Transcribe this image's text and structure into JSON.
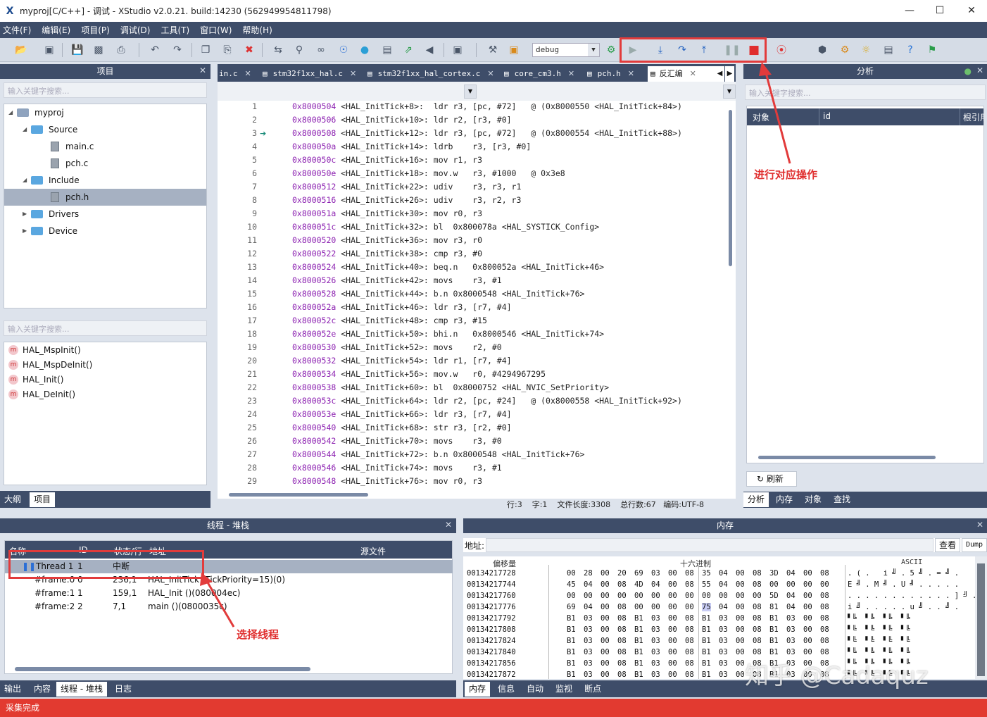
{
  "window": {
    "title": "myproj[C/C++] - 调试 - XStudio v2.0.21. build:14230 (562949954811798)",
    "logo": "X",
    "min": "—",
    "max": "☐",
    "close": "✕"
  },
  "menu": [
    "文件(F)",
    "编辑(E)",
    "项目(P)",
    "调试(D)",
    "工具(T)",
    "窗口(W)",
    "帮助(H)"
  ],
  "toolbar": {
    "config": "debug"
  },
  "project_panel": {
    "title": "项目",
    "search_placeholder": "输入关键字搜索...",
    "tree": [
      {
        "label": "myproj",
        "kind": "project"
      },
      {
        "label": "Source",
        "kind": "folder"
      },
      {
        "label": "main.c",
        "kind": "file"
      },
      {
        "label": "pch.c",
        "kind": "file"
      },
      {
        "label": "Include",
        "kind": "folder"
      },
      {
        "label": "pch.h",
        "kind": "file",
        "selected": true
      },
      {
        "label": "Drivers",
        "kind": "folder"
      },
      {
        "label": "Device",
        "kind": "folder"
      }
    ],
    "search2_placeholder": "输入关键字搜索...",
    "functions": [
      "HAL_MspInit()",
      "HAL_MspDeInit()",
      "HAL_Init()",
      "HAL_DeInit()"
    ],
    "func_badge": "m",
    "tabs": [
      "大纲",
      "项目"
    ]
  },
  "editor": {
    "tabs": [
      "in.c",
      "stm32f1xx_hal.c",
      "stm32f1xx_hal_cortex.c",
      "core_cm3.h",
      "pch.h",
      "反汇编"
    ],
    "active_tab": "反汇编",
    "lines": [
      {
        "n": "1",
        "addr": "0x8000504",
        "text": " <HAL_InitTick+8>:  ldr r3, [pc, #72]   @ (0x8000550 <HAL_InitTick+84>)"
      },
      {
        "n": "2",
        "addr": "0x8000506",
        "text": " <HAL_InitTick+10>: ldr r2, [r3, #0]"
      },
      {
        "n": "3",
        "addr": "0x8000508",
        "text": " <HAL_InitTick+12>: ldr r3, [pc, #72]   @ (0x8000554 <HAL_InitTick+88>)"
      },
      {
        "n": "4",
        "addr": "0x800050a",
        "text": " <HAL_InitTick+14>: ldrb    r3, [r3, #0]"
      },
      {
        "n": "5",
        "addr": "0x800050c",
        "text": " <HAL_InitTick+16>: mov r1, r3"
      },
      {
        "n": "6",
        "addr": "0x800050e",
        "text": " <HAL_InitTick+18>: mov.w   r3, #1000   @ 0x3e8"
      },
      {
        "n": "7",
        "addr": "0x8000512",
        "text": " <HAL_InitTick+22>: udiv    r3, r3, r1"
      },
      {
        "n": "8",
        "addr": "0x8000516",
        "text": " <HAL_InitTick+26>: udiv    r3, r2, r3"
      },
      {
        "n": "9",
        "addr": "0x800051a",
        "text": " <HAL_InitTick+30>: mov r0, r3"
      },
      {
        "n": "10",
        "addr": "0x800051c",
        "text": " <HAL_InitTick+32>: bl  0x800078a <HAL_SYSTICK_Config>"
      },
      {
        "n": "11",
        "addr": "0x8000520",
        "text": " <HAL_InitTick+36>: mov r3, r0"
      },
      {
        "n": "12",
        "addr": "0x8000522",
        "text": " <HAL_InitTick+38>: cmp r3, #0"
      },
      {
        "n": "13",
        "addr": "0x8000524",
        "text": " <HAL_InitTick+40>: beq.n   0x800052a <HAL_InitTick+46>"
      },
      {
        "n": "14",
        "addr": "0x8000526",
        "text": " <HAL_InitTick+42>: movs    r3, #1"
      },
      {
        "n": "15",
        "addr": "0x8000528",
        "text": " <HAL_InitTick+44>: b.n 0x8000548 <HAL_InitTick+76>"
      },
      {
        "n": "16",
        "addr": "0x800052a",
        "text": " <HAL_InitTick+46>: ldr r3, [r7, #4]"
      },
      {
        "n": "17",
        "addr": "0x800052c",
        "text": " <HAL_InitTick+48>: cmp r3, #15"
      },
      {
        "n": "18",
        "addr": "0x800052e",
        "text": " <HAL_InitTick+50>: bhi.n   0x8000546 <HAL_InitTick+74>"
      },
      {
        "n": "19",
        "addr": "0x8000530",
        "text": " <HAL_InitTick+52>: movs    r2, #0"
      },
      {
        "n": "20",
        "addr": "0x8000532",
        "text": " <HAL_InitTick+54>: ldr r1, [r7, #4]"
      },
      {
        "n": "21",
        "addr": "0x8000534",
        "text": " <HAL_InitTick+56>: mov.w   r0, #4294967295"
      },
      {
        "n": "22",
        "addr": "0x8000538",
        "text": " <HAL_InitTick+60>: bl  0x8000752 <HAL_NVIC_SetPriority>"
      },
      {
        "n": "23",
        "addr": "0x800053c",
        "text": " <HAL_InitTick+64>: ldr r2, [pc, #24]   @ (0x8000558 <HAL_InitTick+92>)"
      },
      {
        "n": "24",
        "addr": "0x800053e",
        "text": " <HAL_InitTick+66>: ldr r3, [r7, #4]"
      },
      {
        "n": "25",
        "addr": "0x8000540",
        "text": " <HAL_InitTick+68>: str r3, [r2, #0]"
      },
      {
        "n": "26",
        "addr": "0x8000542",
        "text": " <HAL_InitTick+70>: movs    r3, #0"
      },
      {
        "n": "27",
        "addr": "0x8000544",
        "text": " <HAL_InitTick+72>: b.n 0x8000548 <HAL_InitTick+76>"
      },
      {
        "n": "28",
        "addr": "0x8000546",
        "text": " <HAL_InitTick+74>: movs    r3, #1"
      },
      {
        "n": "29",
        "addr": "0x8000548",
        "text": " <HAL_InitTick+76>: mov r0, r3"
      }
    ],
    "status": "行:3    字:1    文件长度:3308    总行数:67   编码:UTF-8"
  },
  "analysis_panel": {
    "title": "分析",
    "search_placeholder": "输入关键字搜索...",
    "columns": [
      "对象",
      "id",
      "根引用"
    ],
    "refresh": "刷新",
    "tabs": [
      "分析",
      "内存",
      "对象",
      "查找"
    ]
  },
  "annotations": {
    "top": "进行对应操作",
    "bottom": "选择线程"
  },
  "thread_panel": {
    "title": "线程 - 堆栈",
    "columns": [
      "名称",
      "ID",
      "状态/行",
      "地址",
      "源文件"
    ],
    "rows": [
      {
        "name": "Thread 1",
        "id": "1",
        "state": "中断",
        "addr": ""
      },
      {
        "name": "#frame:0",
        "id": "0",
        "state": "236,1",
        "addr": "HAL_InitTick (TickPriority=15)(0)"
      },
      {
        "name": "#frame:1",
        "id": "1",
        "state": "159,1",
        "addr": "HAL_Init ()(080004ec)"
      },
      {
        "name": "#frame:2",
        "id": "2",
        "state": "7,1",
        "addr": "main ()(0800035c)"
      }
    ],
    "tabs": [
      "输出",
      "内容",
      "线程 - 堆栈",
      "日志"
    ]
  },
  "memory_panel": {
    "title": "内存",
    "addr_label": "地址:",
    "view_btn": "查看",
    "dump_btn": "Dump",
    "col_offset": "偏移量",
    "col_hex": "十六进制",
    "col_ascii": "ASCII",
    "rows": [
      {
        "off": "00134217728",
        "hex": [
          "00",
          "28",
          "00",
          "20",
          "69",
          "03",
          "00",
          "08",
          "35",
          "04",
          "00",
          "08",
          "3D",
          "04",
          "00",
          "08"
        ],
        "ascii": ". ( .   i ╝ . 5 ╝ . = ╝ ."
      },
      {
        "off": "00134217744",
        "hex": [
          "45",
          "04",
          "00",
          "08",
          "4D",
          "04",
          "00",
          "08",
          "55",
          "04",
          "00",
          "08",
          "00",
          "00",
          "00",
          "00"
        ],
        "ascii": "E ╝ . M ╝ . U ╝ . . . . ."
      },
      {
        "off": "00134217760",
        "hex": [
          "00",
          "00",
          "00",
          "00",
          "00",
          "00",
          "00",
          "00",
          "00",
          "00",
          "00",
          "00",
          "5D",
          "04",
          "00",
          "08"
        ],
        "ascii": ". . . . . . . . . . . . ] ╝ ."
      },
      {
        "off": "00134217776",
        "hex": [
          "69",
          "04",
          "00",
          "08",
          "00",
          "00",
          "00",
          "00",
          "75",
          "04",
          "00",
          "08",
          "81",
          "04",
          "00",
          "08"
        ],
        "ascii": "i ╝ . . . . . u ╝ . . ╝ ."
      },
      {
        "off": "00134217792",
        "hex": [
          "B1",
          "03",
          "00",
          "08",
          "B1",
          "03",
          "00",
          "08",
          "B1",
          "03",
          "00",
          "08",
          "B1",
          "03",
          "00",
          "08"
        ],
        "ascii": "▘╚  ▘╚  ▘╚  ▘╚"
      },
      {
        "off": "00134217808",
        "hex": [
          "B1",
          "03",
          "00",
          "08",
          "B1",
          "03",
          "00",
          "08",
          "B1",
          "03",
          "00",
          "08",
          "B1",
          "03",
          "00",
          "08"
        ],
        "ascii": "▘╚  ▘╚  ▘╚  ▘╚"
      },
      {
        "off": "00134217824",
        "hex": [
          "B1",
          "03",
          "00",
          "08",
          "B1",
          "03",
          "00",
          "08",
          "B1",
          "03",
          "00",
          "08",
          "B1",
          "03",
          "00",
          "08"
        ],
        "ascii": "▘╚  ▘╚  ▘╚  ▘╚"
      },
      {
        "off": "00134217840",
        "hex": [
          "B1",
          "03",
          "00",
          "08",
          "B1",
          "03",
          "00",
          "08",
          "B1",
          "03",
          "00",
          "08",
          "B1",
          "03",
          "00",
          "08"
        ],
        "ascii": "▘╚  ▘╚  ▘╚  ▘╚"
      },
      {
        "off": "00134217856",
        "hex": [
          "B1",
          "03",
          "00",
          "08",
          "B1",
          "03",
          "00",
          "08",
          "B1",
          "03",
          "00",
          "08",
          "B1",
          "03",
          "00",
          "08"
        ],
        "ascii": "▘╚  ▘╚  ▘╚  ▘╚"
      },
      {
        "off": "00134217872",
        "hex": [
          "B1",
          "03",
          "00",
          "08",
          "B1",
          "03",
          "00",
          "08",
          "B1",
          "03",
          "00",
          "08",
          "B1",
          "03",
          "00",
          "08"
        ],
        "ascii": "▘╚  ▘╚  ▘╚  ▘╚"
      }
    ],
    "tabs": [
      "内存",
      "信息",
      "自动",
      "监视",
      "断点"
    ]
  },
  "watermark": "知乎 @Cadaquz",
  "statusbar": "采集完成"
}
